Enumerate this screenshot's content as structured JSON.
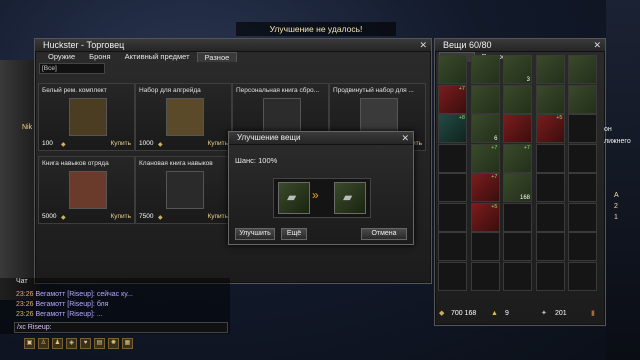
{
  "trader": {
    "title": "Huckster - Торговец",
    "tabs": [
      "Оружие",
      "Броня",
      "Активный предмет",
      "Разное"
    ],
    "filter": "[Все]",
    "items": [
      {
        "name": "Белый рем. комплект",
        "price": "100",
        "buy": "Купить"
      },
      {
        "name": "Набор для апгрейда",
        "price": "1000",
        "buy": "Купить"
      },
      {
        "name": "Персональная книга сбро...",
        "price": "",
        "buy": "Купить"
      },
      {
        "name": "Продвинутый набор для ...",
        "price": "",
        "buy": "Купить"
      },
      {
        "name": "Книга навыков отряда",
        "price": "5000",
        "buy": "Купить"
      },
      {
        "name": "Клановая книга навыков",
        "price": "7500",
        "buy": "Купить"
      }
    ]
  },
  "notice": "Улучшение не удалось!",
  "upgrade": {
    "title": "Улучшение вещи",
    "chance": "Шанс: 100%",
    "upgrade_btn": "Улучшить",
    "all_btn": "Ещё",
    "cancel_btn": "Отмена"
  },
  "inventory": {
    "title": "Вещи 60/80",
    "tabs": [
      "Вещи",
      "Ресурсы"
    ],
    "money": "700 168",
    "res1": "9",
    "res2": "201",
    "cells": [
      {
        "kind": "it",
        "lv": "",
        "qty": ""
      },
      {
        "kind": "it",
        "lv": "",
        "qty": ""
      },
      {
        "kind": "it",
        "lv": "",
        "qty": "3"
      },
      {
        "kind": "it",
        "lv": "",
        "qty": ""
      },
      {
        "kind": "it",
        "lv": "",
        "qty": ""
      },
      {
        "kind": "red",
        "lv": "+7",
        "qty": ""
      },
      {
        "kind": "it",
        "lv": "",
        "qty": ""
      },
      {
        "kind": "it",
        "lv": "",
        "qty": ""
      },
      {
        "kind": "it",
        "lv": "",
        "qty": ""
      },
      {
        "kind": "it",
        "lv": "",
        "qty": ""
      },
      {
        "kind": "teal",
        "lv": "+8",
        "qty": ""
      },
      {
        "kind": "it",
        "lv": "",
        "qty": "6"
      },
      {
        "kind": "red",
        "lv": "",
        "qty": ""
      },
      {
        "kind": "red",
        "lv": "+5",
        "qty": ""
      },
      {
        "kind": "",
        "lv": "",
        "qty": ""
      },
      {
        "kind": "",
        "lv": "",
        "qty": ""
      },
      {
        "kind": "it",
        "lv": "+7",
        "qty": ""
      },
      {
        "kind": "it",
        "lv": "+7",
        "qty": ""
      },
      {
        "kind": "",
        "lv": "",
        "qty": ""
      },
      {
        "kind": "",
        "lv": "",
        "qty": ""
      },
      {
        "kind": "",
        "lv": "",
        "qty": ""
      },
      {
        "kind": "red",
        "lv": "+7",
        "qty": ""
      },
      {
        "kind": "it",
        "lv": "",
        "qty": "168"
      },
      {
        "kind": "",
        "lv": "",
        "qty": ""
      },
      {
        "kind": "",
        "lv": "",
        "qty": ""
      },
      {
        "kind": "",
        "lv": "",
        "qty": ""
      },
      {
        "kind": "red",
        "lv": "+5",
        "qty": ""
      },
      {
        "kind": "",
        "lv": "",
        "qty": ""
      },
      {
        "kind": "",
        "lv": "",
        "qty": ""
      },
      {
        "kind": "",
        "lv": "",
        "qty": ""
      },
      {
        "kind": "",
        "lv": "",
        "qty": ""
      },
      {
        "kind": "",
        "lv": "",
        "qty": ""
      },
      {
        "kind": "",
        "lv": "",
        "qty": ""
      },
      {
        "kind": "",
        "lv": "",
        "qty": ""
      },
      {
        "kind": "",
        "lv": "",
        "qty": ""
      },
      {
        "kind": "",
        "lv": "",
        "qty": ""
      },
      {
        "kind": "",
        "lv": "",
        "qty": ""
      },
      {
        "kind": "",
        "lv": "",
        "qty": ""
      },
      {
        "kind": "",
        "lv": "",
        "qty": ""
      },
      {
        "kind": "",
        "lv": "",
        "qty": ""
      }
    ]
  },
  "chat": {
    "tab": "Чат",
    "lines": [
      {
        "time": "23:26",
        "text": "Вегамотт [Risеup]: сейчас ку..."
      },
      {
        "time": "23:26",
        "text": "Вегамотт [Risеup]: бля"
      },
      {
        "time": "23:26",
        "text": "Вегамотт [Risеup]: ..."
      }
    ],
    "input": "/хс Risеup:"
  },
  "side_text": {
    "a": "Nik",
    "b": "он",
    "c": "лижнего"
  },
  "side_markers": [
    "A",
    "2",
    "1"
  ],
  "hud_icons": [
    "bag",
    "person",
    "group",
    "shield",
    "heart",
    "box",
    "gear",
    "map"
  ]
}
